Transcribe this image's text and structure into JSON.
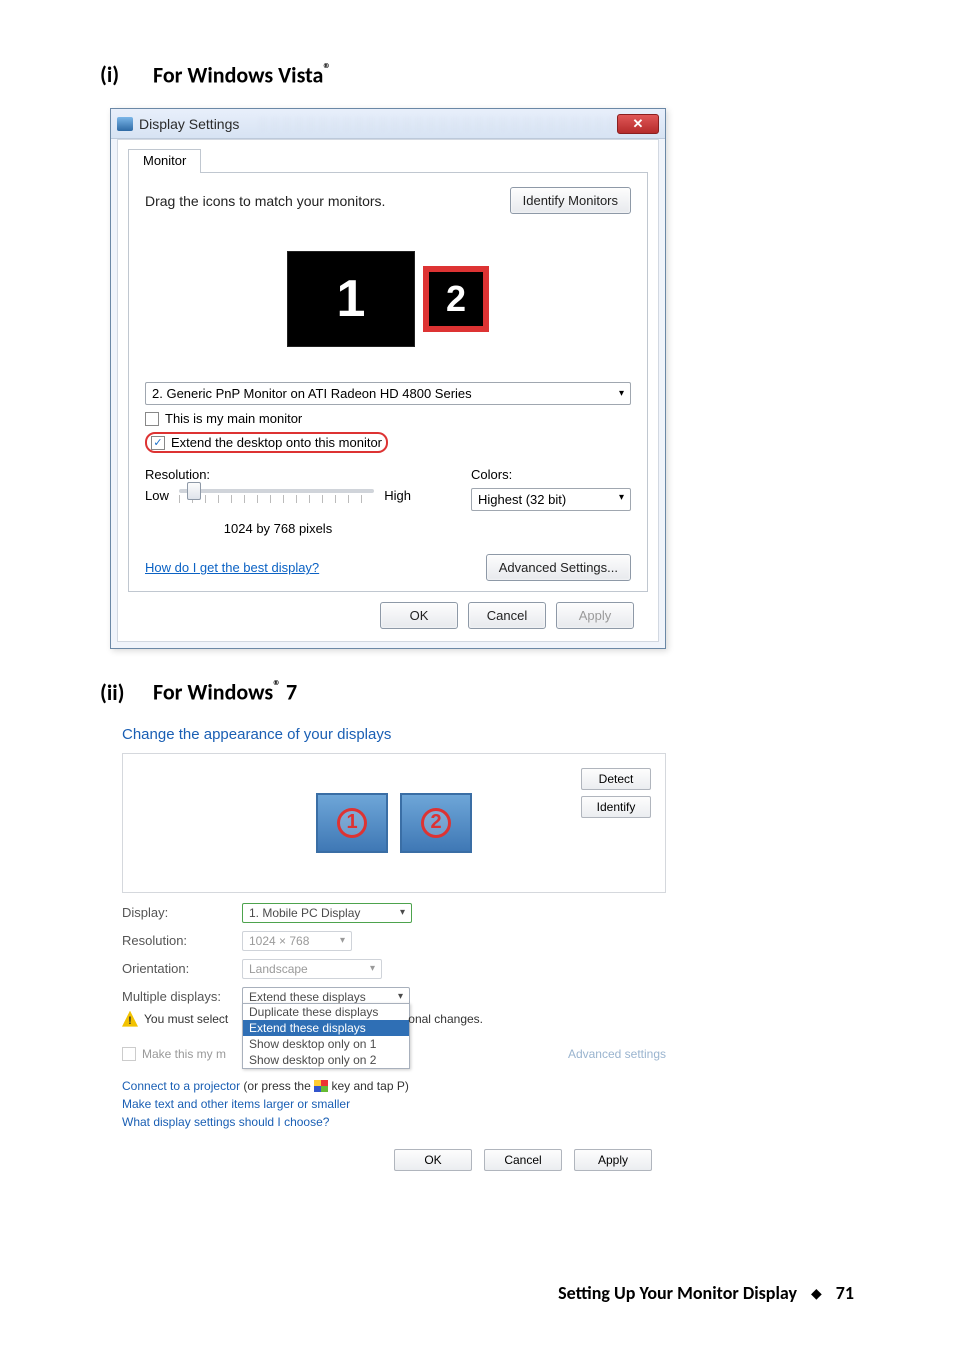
{
  "headings": {
    "vista_num": "(i)",
    "vista_text": "For Windows Vista",
    "vista_reg": "®",
    "win7_num": "(ii)",
    "win7_text_a": "For Windows",
    "win7_reg": "®",
    "win7_text_b": " 7"
  },
  "vista": {
    "window_title": "Display Settings",
    "close_glyph": "✕",
    "tab": "Monitor",
    "instruction": "Drag the icons to match your monitors.",
    "identify_btn": "Identify Monitors",
    "monitor1": "1",
    "monitor2": "2",
    "selected_monitor": "2. Generic PnP Monitor on ATI Radeon HD 4800 Series",
    "chk_main": "This is my main monitor",
    "chk_extend": "Extend the desktop onto this monitor",
    "checkmark": "✓",
    "resolution_label": "Resolution:",
    "colors_label": "Colors:",
    "low": "Low",
    "high": "High",
    "res_value": "1024 by 768 pixels",
    "colors_value": "Highest (32 bit)",
    "help_link": "How do I get the best display?",
    "advanced_btn": "Advanced Settings...",
    "ok": "OK",
    "cancel": "Cancel",
    "apply": "Apply",
    "arrow": "▾"
  },
  "win7": {
    "heading": "Change the appearance of your displays",
    "detect": "Detect",
    "identify": "Identify",
    "mon1": "1",
    "mon2": "2",
    "display_label": "Display:",
    "display_value": "1. Mobile PC Display",
    "resolution_label": "Resolution:",
    "resolution_value": "1024 × 768",
    "orientation_label": "Orientation:",
    "orientation_value": "Landscape",
    "multi_label": "Multiple displays:",
    "multi_value": "Extend these displays",
    "options": [
      "Duplicate these displays",
      "Extend these displays",
      "Show desktop only on 1",
      "Show desktop only on 2"
    ],
    "warn_a": "You must select",
    "warn_b": "onal changes.",
    "main_chk": "Make this my m",
    "advanced": "Advanced settings",
    "link1a": "Connect to a projector",
    "link1b": " (or press the ",
    "link1c": " key and tap P)",
    "link2": "Make text and other items larger or smaller",
    "link3": "What display settings should I choose?",
    "ok": "OK",
    "cancel": "Cancel",
    "apply": "Apply",
    "arrow": "▾",
    "warn_mark": "!"
  },
  "footer": {
    "title": "Setting Up Your Monitor Display",
    "diamond": "◆",
    "page": "71"
  }
}
